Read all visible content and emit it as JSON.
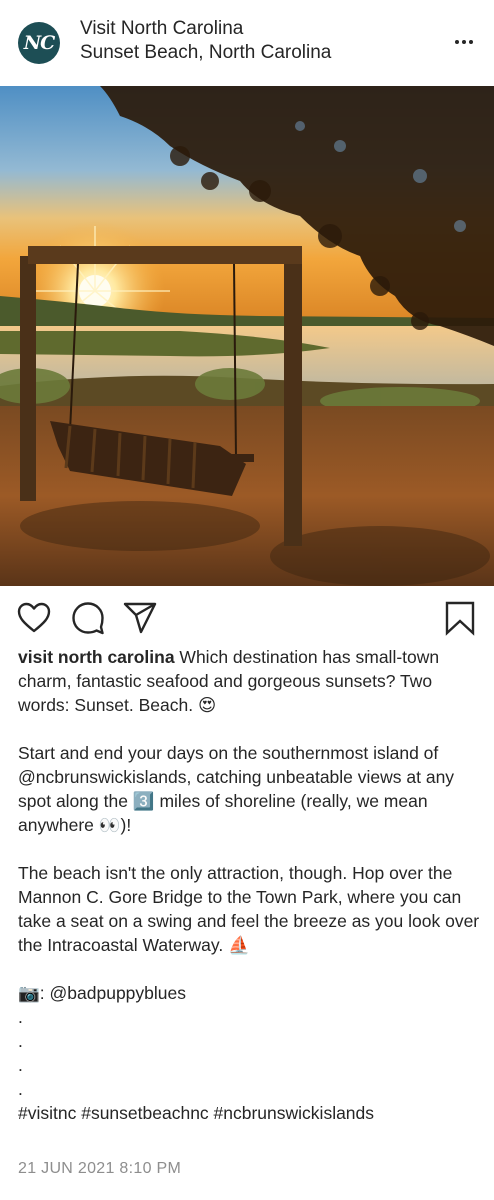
{
  "post": {
    "account_name": "Visit North Carolina",
    "location": "Sunset Beach, North Carolina",
    "avatar_initials": "NC",
    "more_icon": "more-horizontal-icon",
    "photo_alt": "Wooden porch swing at sunset overlooking the Intracoastal Waterway",
    "actions": {
      "like_icon": "heart-icon",
      "comment_icon": "comment-icon",
      "share_icon": "share-icon",
      "save_icon": "bookmark-icon"
    },
    "caption": {
      "username": "visit north carolina",
      "text": " Which destination has small-town charm, fantastic seafood and gorgeous sunsets? Two words: Sunset. Beach. 😍\n\nStart and end your days on the southernmost island of @ncbrunswickislands, catching unbeatable views at any spot along the 3️⃣ miles of shoreline (really, we mean anywhere 👀)!\n\nThe beach isn't the only attraction, though. Hop over the Mannon C. Gore Bridge to the Town Park, where you can take a seat on a swing and feel the breeze as you look over the Intracoastal Waterway. ⛵\n\n📷: @badpuppyblues\n.\n.\n.\n.\n#visitnc #sunsetbeachnc #ncbrunswickislands"
    },
    "timestamp": "21 JUN 2021 8:10 PM"
  },
  "colors": {
    "text": "#262626",
    "muted": "#8e8e8e",
    "avatar_bg": "#1d4e55"
  }
}
